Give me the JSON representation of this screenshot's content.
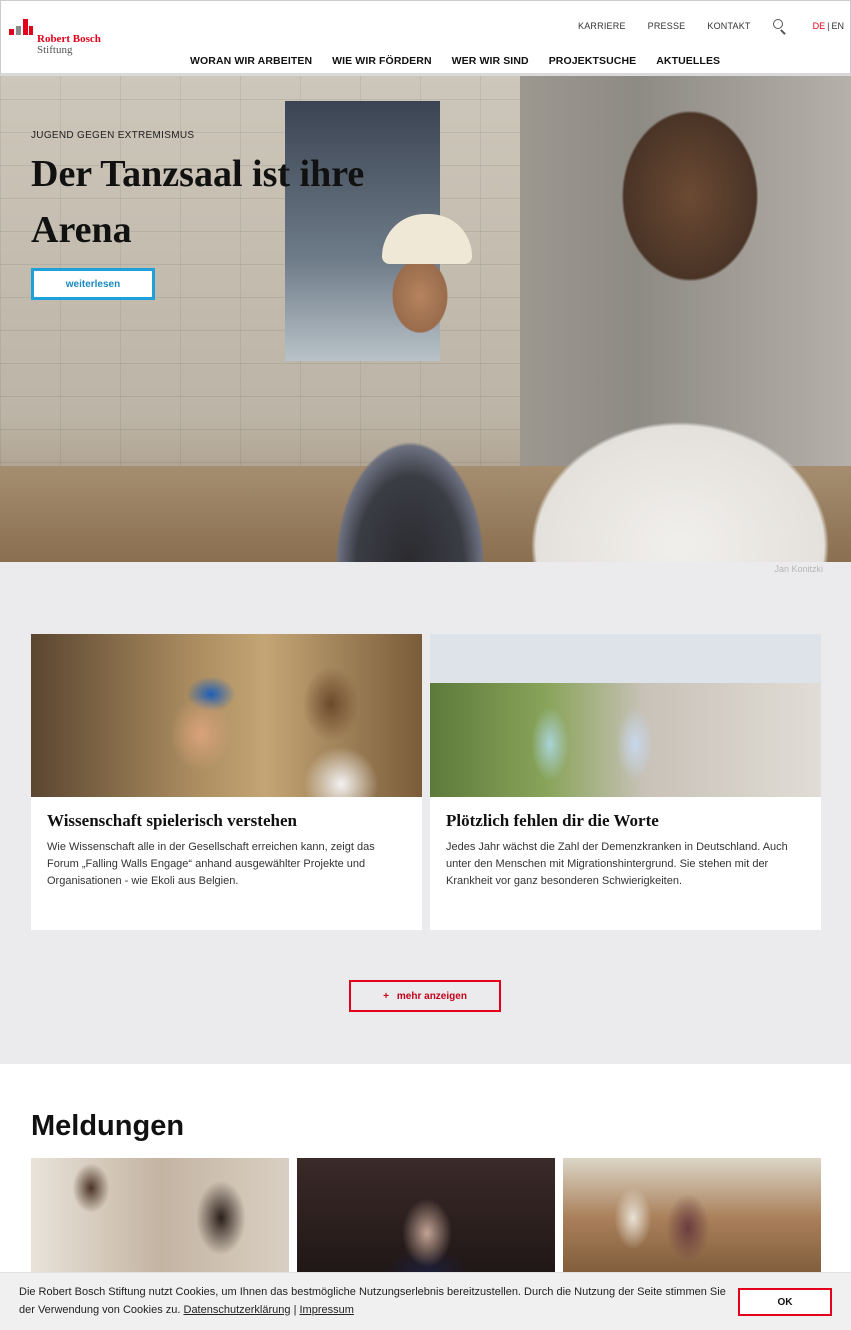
{
  "brand": {
    "name_line1": "Robert Bosch",
    "name_line2": "Stiftung",
    "accent_color": "#e2001a"
  },
  "topnav": {
    "items": [
      "KARRIERE",
      "PRESSE",
      "KONTAKT"
    ],
    "search_icon": "search-icon",
    "lang_de": "DE",
    "lang_sep": "|",
    "lang_en": "EN"
  },
  "mainnav": {
    "items": [
      "WORAN WIR ARBEITEN",
      "WIE WIR FÖRDERN",
      "WER WIR SIND",
      "PROJEKTSUCHE",
      "AKTUELLES"
    ]
  },
  "hero": {
    "category": "JUGEND GEGEN EXTREMISMUS",
    "title": "Der Tanzsaal ist ihre Arena",
    "button": "weiterlesen",
    "credit": "Jan Konitzki"
  },
  "cards": [
    {
      "title": "Wissenschaft spielerisch verstehen",
      "text": "Wie Wissenschaft alle in der Gesellschaft erreichen kann, zeigt das Forum „Falling Walls Engage“ anhand ausgewählter Projekte und Organisationen - wie Ekoli aus Belgien."
    },
    {
      "title": "Plötzlich fehlen dir die Worte",
      "text": "Jedes Jahr wächst die Zahl der Demenzkranken in Deutschland. Auch unter den Menschen mit Migrationshintergrund. Sie stehen mit der Krankheit vor ganz besonderen Schwierigkeiten."
    }
  ],
  "more_button": {
    "plus": "+",
    "label": "mehr anzeigen"
  },
  "meldungen": {
    "title": "Meldungen"
  },
  "cookie": {
    "text": "Die Robert Bosch Stiftung nutzt Cookies, um Ihnen das bestmögliche Nutzungserlebnis bereitzustellen. Durch die Nutzung der Seite stimmen Sie der Verwendung von Cookies zu.",
    "privacy_link": "Datenschutzerklärung",
    "separator": "|",
    "imprint_link": "Impressum",
    "ok_button": "OK"
  }
}
